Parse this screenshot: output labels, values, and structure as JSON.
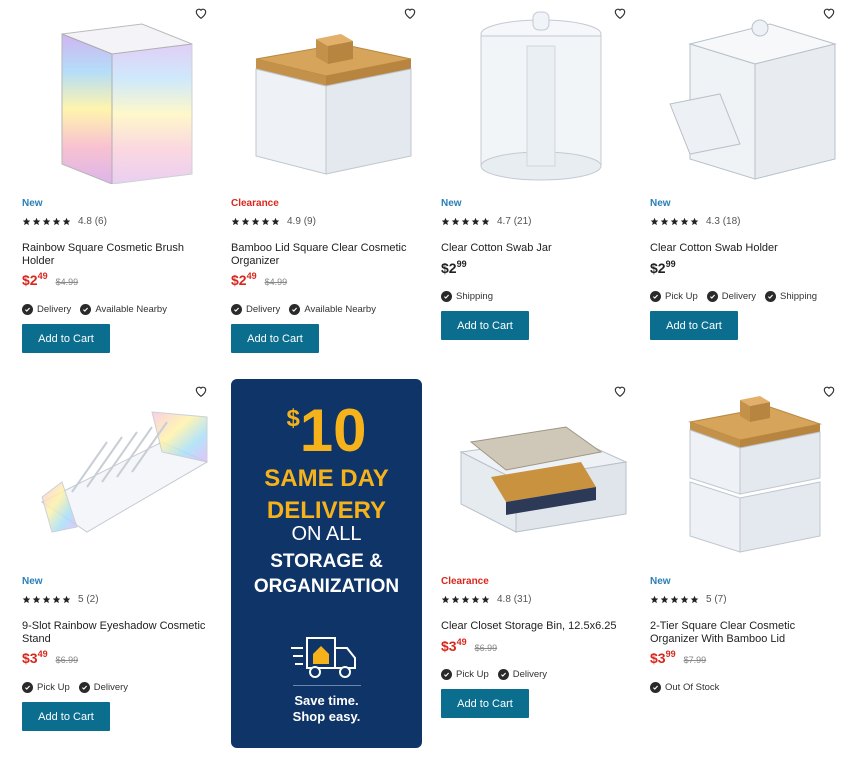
{
  "colors": {
    "new_badge": "#2a7fb8",
    "clearance_badge": "#d8281d",
    "sale_price": "#d8281d",
    "button": "#0b6e8f",
    "promo_bg": "#0e3468",
    "promo_accent": "#f6b21b"
  },
  "products": [
    {
      "badge": "New",
      "badge_type": "new",
      "image_icon": "rainbow-brush-holder-image",
      "rating": "4.8",
      "reviews": "(6)",
      "title": "Rainbow Square Cosmetic Brush Holder",
      "price_main": "$2",
      "price_cents": "49",
      "was_price": "$4.99",
      "fulfillment": [
        "Delivery",
        "Available Nearby"
      ],
      "button": "Add to Cart"
    },
    {
      "badge": "Clearance",
      "badge_type": "clearance",
      "image_icon": "bamboo-lid-organizer-image",
      "rating": "4.9",
      "reviews": "(9)",
      "title": "Bamboo Lid Square Clear Cosmetic Organizer",
      "price_main": "$2",
      "price_cents": "49",
      "was_price": "$4.99",
      "fulfillment": [
        "Delivery",
        "Available Nearby"
      ],
      "button": "Add to Cart"
    },
    {
      "badge": "New",
      "badge_type": "new",
      "image_icon": "cotton-swab-jar-image",
      "rating": "4.7",
      "reviews": "(21)",
      "title": "Clear Cotton Swab Jar",
      "price_main": "$2",
      "price_cents": "99",
      "was_price": "",
      "fulfillment": [
        "Shipping"
      ],
      "button": "Add to Cart"
    },
    {
      "badge": "New",
      "badge_type": "new",
      "image_icon": "cotton-swab-holder-image",
      "rating": "4.3",
      "reviews": "(18)",
      "title": "Clear Cotton Swab Holder",
      "price_main": "$2",
      "price_cents": "99",
      "was_price": "",
      "fulfillment": [
        "Pick Up",
        "Delivery",
        "Shipping"
      ],
      "button": "Add to Cart"
    },
    {
      "badge": "New",
      "badge_type": "new",
      "image_icon": "eyeshadow-stand-image",
      "rating": "5",
      "reviews": "(2)",
      "title": "9-Slot Rainbow Eyeshadow Cosmetic Stand",
      "price_main": "$3",
      "price_cents": "49",
      "was_price": "$6.99",
      "fulfillment": [
        "Pick Up",
        "Delivery"
      ],
      "button": "Add to Cart"
    },
    {
      "badge": "Clearance",
      "badge_type": "clearance",
      "image_icon": "closet-storage-bin-image",
      "rating": "4.8",
      "reviews": "(31)",
      "title": "Clear Closet Storage Bin, 12.5x6.25",
      "price_main": "$3",
      "price_cents": "49",
      "was_price": "$6.99",
      "fulfillment": [
        "Pick Up",
        "Delivery"
      ],
      "button": "Add to Cart"
    },
    {
      "badge": "New",
      "badge_type": "new",
      "image_icon": "two-tier-organizer-image",
      "rating": "5",
      "reviews": "(7)",
      "title": "2-Tier Square Clear Cosmetic Organizer With Bamboo Lid",
      "price_main": "$3",
      "price_cents": "99",
      "was_price": "$7.99",
      "fulfillment": [
        "Out Of Stock"
      ],
      "button": ""
    }
  ],
  "promo": {
    "dollar": "$",
    "amount": "10",
    "line1": "SAME DAY",
    "line2": "DELIVERY",
    "line3": "ON ALL",
    "line4": "STORAGE &",
    "line5": "ORGANIZATION",
    "icon": "delivery-truck-icon",
    "tag1": "Save time.",
    "tag2": "Shop easy."
  }
}
